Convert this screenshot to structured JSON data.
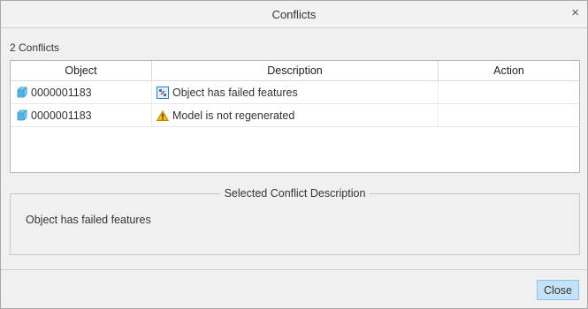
{
  "dialog": {
    "title": "Conflicts",
    "close_glyph": "×"
  },
  "summary": {
    "count_text": "2 Conflicts"
  },
  "table": {
    "columns": [
      "Object",
      "Description",
      "Action"
    ],
    "rows": [
      {
        "object": "0000001183",
        "object_icon": "part-cube-icon",
        "description": "Object has failed features",
        "description_icon": "failed-features-icon",
        "action": ""
      },
      {
        "object": "0000001183",
        "object_icon": "part-cube-icon",
        "description": "Model is not regenerated",
        "description_icon": "warning-icon",
        "action": ""
      }
    ]
  },
  "selected_description": {
    "legend": "Selected Conflict Description",
    "text": "Object has failed features"
  },
  "footer": {
    "close_label": "Close"
  },
  "colors": {
    "accent_button": "#c5e3f6",
    "warning": "#f2b400",
    "part_icon": "#5bb8e8"
  }
}
